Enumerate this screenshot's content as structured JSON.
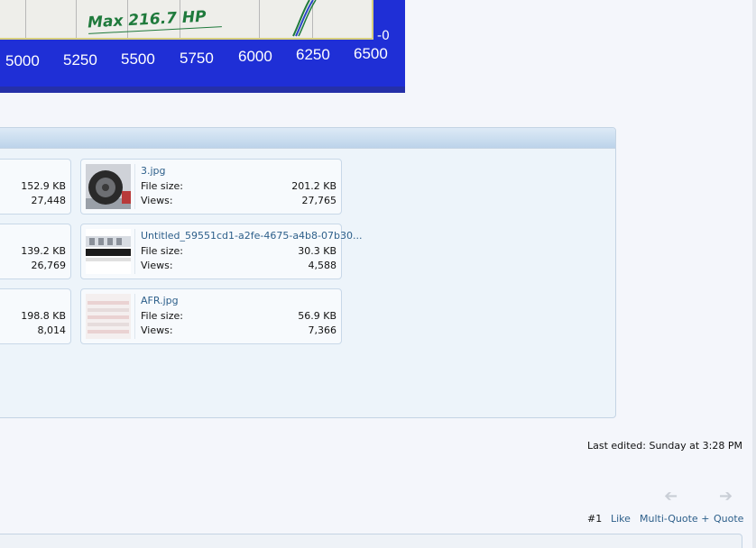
{
  "dyno": {
    "max_label": "Max 216.7 HP",
    "zero_label": "-0",
    "ticks": [
      "5000",
      "5250",
      "5500",
      "5750",
      "6000",
      "6250",
      "6500"
    ]
  },
  "attachments": [
    {
      "name": "",
      "file_size_label": "",
      "file_size": "152.9 KB",
      "views_label": "",
      "views": "27,448",
      "column": "left"
    },
    {
      "name": "3.jpg",
      "file_size_label": "File size:",
      "file_size": "201.2 KB",
      "views_label": "Views:",
      "views": "27,765",
      "column": "right",
      "thumb": "tire"
    },
    {
      "name": "",
      "file_size_label": "",
      "file_size": "139.2 KB",
      "views_label": "",
      "views": "26,769",
      "column": "left"
    },
    {
      "name": "Untitled_59551cd1-a2fe-4675-a4b8-07b30...",
      "file_size_label": "File size:",
      "file_size": "30.3 KB",
      "views_label": "Views:",
      "views": "4,588",
      "column": "right",
      "thumb": "screenshot"
    },
    {
      "name": "",
      "file_size_label": "",
      "file_size": "198.8 KB",
      "views_label": "",
      "views": "8,014",
      "column": "left"
    },
    {
      "name": "AFR.jpg",
      "file_size_label": "File size:",
      "file_size": "56.9 KB",
      "views_label": "Views:",
      "views": "7,366",
      "column": "right",
      "thumb": "chart"
    }
  ],
  "post": {
    "last_edited": "Last edited: Sunday at 3:28 PM",
    "post_number": "#1",
    "like": "Like",
    "multi_quote": "Multi-Quote +",
    "quote": "Quote"
  }
}
